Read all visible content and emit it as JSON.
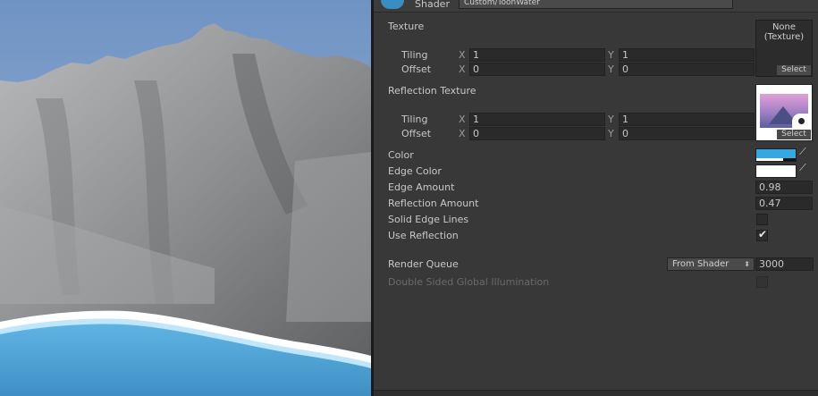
{
  "scene": {
    "water_color": "#5aaee0",
    "foam_color": "#ffffff",
    "sky_color": "#8fa8cb"
  },
  "shader": {
    "label": "Shader",
    "value": "Custom/ToonWater"
  },
  "texture": {
    "label": "Texture",
    "slot_text_line1": "None",
    "slot_text_line2": "(Texture)",
    "select_label": "Select",
    "tiling": {
      "label": "Tiling",
      "x_axis": "X",
      "x": "1",
      "y_axis": "Y",
      "y": "1"
    },
    "offset": {
      "label": "Offset",
      "x_axis": "X",
      "x": "0",
      "y_axis": "Y",
      "y": "0"
    }
  },
  "reflection_texture": {
    "label": "Reflection Texture",
    "select_label": "Select",
    "tiling": {
      "label": "Tiling",
      "x_axis": "X",
      "x": "1",
      "y_axis": "Y",
      "y": "1"
    },
    "offset": {
      "label": "Offset",
      "x_axis": "X",
      "x": "0",
      "y_axis": "Y",
      "y": "0"
    }
  },
  "properties": {
    "color": {
      "label": "Color",
      "value": "#34a8e2"
    },
    "edge_color": {
      "label": "Edge Color",
      "value": "#ffffff"
    },
    "edge_amount": {
      "label": "Edge Amount",
      "value": "0.98"
    },
    "reflection_amount": {
      "label": "Reflection Amount",
      "value": "0.47"
    },
    "solid_edge_lines": {
      "label": "Solid Edge Lines",
      "checked": false
    },
    "use_reflection": {
      "label": "Use Reflection",
      "checked": true
    }
  },
  "render_queue": {
    "label": "Render Queue",
    "mode": "From Shader",
    "value": "3000"
  },
  "double_sided_gi": {
    "label": "Double Sided Global Illumination",
    "checked": false
  }
}
